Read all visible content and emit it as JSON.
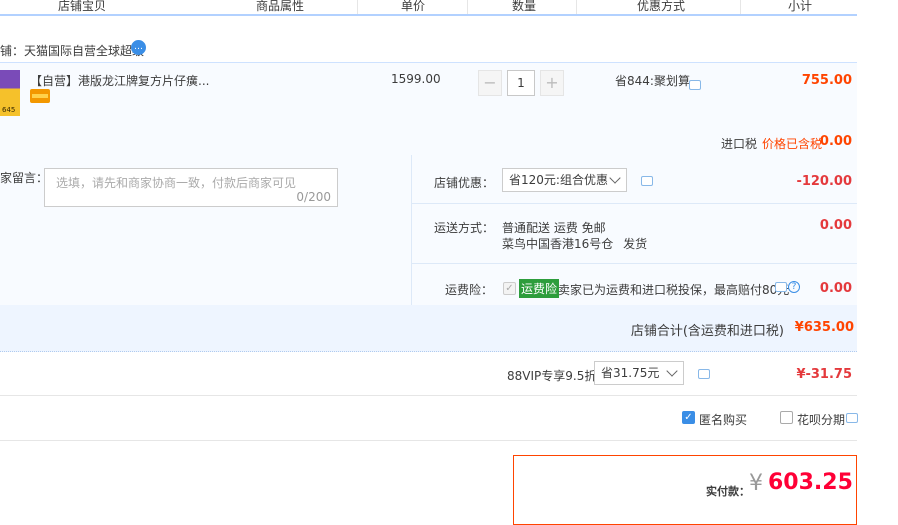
{
  "header": {
    "columns": [
      "店铺宝贝",
      "商品属性",
      "单价",
      "数量",
      "优惠方式",
      "小计"
    ]
  },
  "shop": {
    "name_line": "铺：天猫国际自营全球超级"
  },
  "item": {
    "thumb_label": "645",
    "title": "【自营】港版龙江牌复方片仔癀...",
    "unit_price": "1599.00",
    "quantity": "1",
    "qty_minus": "−",
    "qty_plus": "+",
    "discount_method": "省844:聚划算",
    "subtotal": "755.00",
    "import_tax_label": "进口税",
    "tax_included": "价格已含税",
    "import_tax_value": "0.00"
  },
  "message": {
    "label": "家留言：",
    "placeholder": "选填，请先和商家协商一致，付款后商家可见",
    "counter": "0/200"
  },
  "shop_discount": {
    "label": "店铺优惠：",
    "selected": "省120元:组合优惠",
    "value": "-120.00"
  },
  "shipping": {
    "label": "运送方式：",
    "method": "普通配送 运费 免邮",
    "warehouse": "菜鸟中国香港16号仓",
    "ship_text": "发货",
    "value": "0.00"
  },
  "shipping_insurance": {
    "label": "运费险：",
    "badge": "运费险",
    "desc": "卖家已为运费和进口税投保，最高赔付80元",
    "value": "0.00"
  },
  "shop_total": {
    "label": "店铺合计(含运费和进口税)",
    "value": "¥635.00"
  },
  "vip": {
    "label": "88VIP专享9.5折",
    "selected": "省31.75元",
    "value": "¥-31.75"
  },
  "options": {
    "anonymous": "匿名购买",
    "anonymous_checked": true,
    "installment": "花呗分期",
    "installment_checked": false
  },
  "payment": {
    "label": "实付款：",
    "currency": "¥",
    "amount": "603.25"
  },
  "colors": {
    "accent_blue": "#3a8ee6",
    "price_orange": "#ff4400",
    "price_red": "#e4393c",
    "badge_green": "#2d9d3c"
  }
}
